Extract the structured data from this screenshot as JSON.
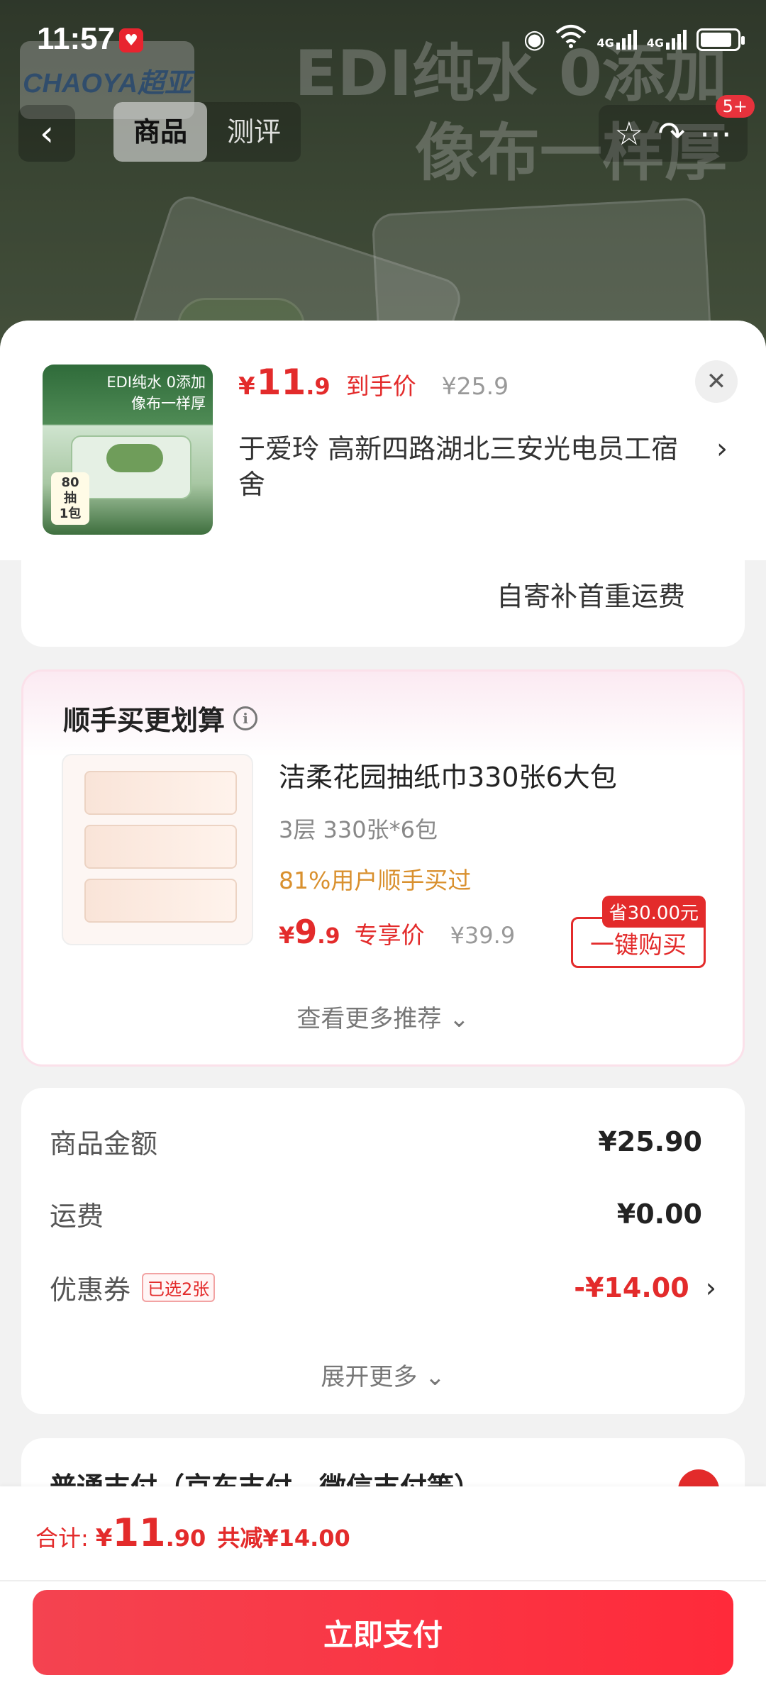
{
  "status_bar": {
    "time": "11:57",
    "network_1": "4G",
    "network_2": "4G",
    "battery_percent": 85,
    "icons": [
      "eye-icon",
      "wifi-icon",
      "signal-icon",
      "battery-icon"
    ]
  },
  "background_page": {
    "logo_text": "CHAOYA超亚",
    "headline_line1": "EDI纯水 0添加",
    "headline_line2": "像布一样厚",
    "tabs": [
      {
        "label": "商品",
        "active": true
      },
      {
        "label": "测评",
        "active": false
      }
    ],
    "badge": "5+"
  },
  "product": {
    "thumb_text_line1": "EDI纯水 0添加",
    "thumb_text_line2": "像布一样厚",
    "thumb_tag_line1": "80抽",
    "thumb_tag_line2": "1包",
    "price_currency": "¥",
    "price_int": "11",
    "price_dec": ".9",
    "price_label": "到手价",
    "original_price": "¥25.9",
    "address": "于爱玲  高新四路湖北三安光电员工宿舍"
  },
  "shipping": {
    "text": "自寄补首重运费"
  },
  "addon": {
    "title": "顺手买更划算",
    "name": "洁柔花园抽纸巾330张6大包",
    "spec": "3层 330张*6包",
    "social_proof": "81%用户顺手买过",
    "price_currency": "¥",
    "price_int": "9",
    "price_dec": ".9",
    "price_label": "专享价",
    "original_price": "¥39.9",
    "save_badge": "省30.00元",
    "buy_button": "一键购买",
    "more_recommend": "查看更多推荐 ⌄"
  },
  "summary": {
    "goods_label": "商品金额",
    "goods_value": "¥25.90",
    "shipping_label": "运费",
    "shipping_value": "¥0.00",
    "coupon_label": "优惠券",
    "coupon_chip": "已选2张",
    "coupon_value": "-¥14.00",
    "expand_more": "展开更多 ⌄"
  },
  "payment": {
    "method_text": "普通支付（京东支付、微信支付等）"
  },
  "footer": {
    "total_label": "合计:",
    "total_currency": "¥",
    "total_int": "11",
    "total_dec": ".90",
    "total_saved": "共减¥14.00",
    "pay_button": "立即支付"
  },
  "colors": {
    "accent_red": "#e32b2b",
    "pay_button": "#ff2a3a",
    "social_orange": "#d9902e"
  }
}
